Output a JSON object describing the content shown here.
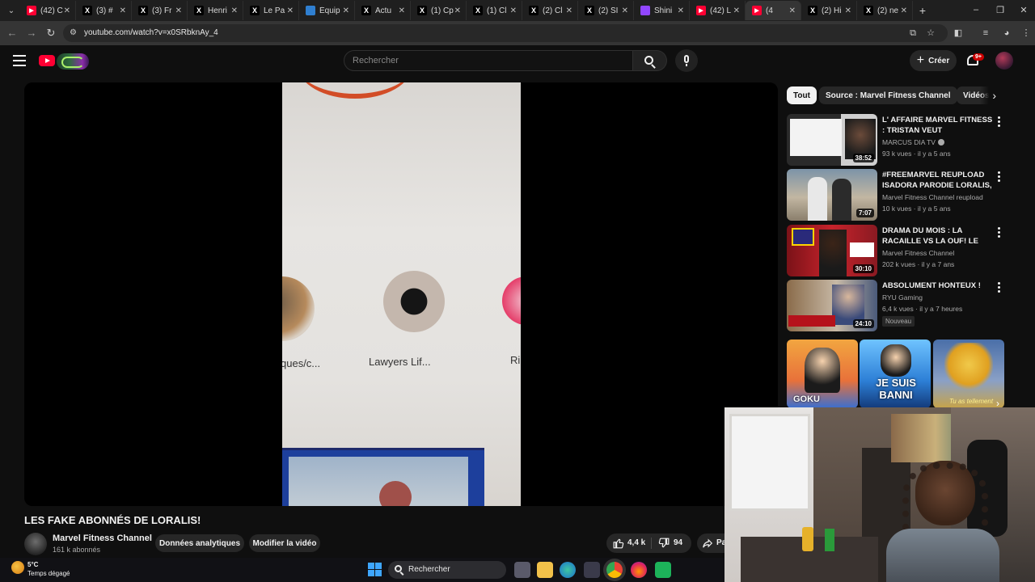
{
  "browser": {
    "tabs": [
      {
        "title": "(42) C",
        "icon": "youtube-icon",
        "color": "#ff0033"
      },
      {
        "title": "(3) #",
        "icon": "x-icon",
        "color": "#000000"
      },
      {
        "title": "(3) Fr",
        "icon": "x-icon",
        "color": "#000000"
      },
      {
        "title": "Henri",
        "icon": "x-icon",
        "color": "#000000"
      },
      {
        "title": "Le Pa",
        "icon": "x-icon",
        "color": "#000000"
      },
      {
        "title": "Équip",
        "icon": "bookmark-icon",
        "color": "#2f7fd0"
      },
      {
        "title": "Actu",
        "icon": "x-icon",
        "color": "#000000"
      },
      {
        "title": "(1) Cp",
        "icon": "x-icon",
        "color": "#000000"
      },
      {
        "title": "(1) Cl",
        "icon": "x-icon",
        "color": "#000000"
      },
      {
        "title": "(2) Cl",
        "icon": "x-icon",
        "color": "#000000"
      },
      {
        "title": "(2) SI",
        "icon": "x-icon",
        "color": "#000000"
      },
      {
        "title": "Shini",
        "icon": "twitch-icon",
        "color": "#9146ff"
      },
      {
        "title": "(42) L",
        "icon": "youtube-icon",
        "color": "#ff0033"
      },
      {
        "title": "(4",
        "icon": "youtube-icon",
        "color": "#ff0033",
        "active": true
      },
      {
        "title": "(2) Hi",
        "icon": "x-icon",
        "color": "#000000"
      },
      {
        "title": "(2) ne",
        "icon": "x-icon",
        "color": "#000000"
      }
    ],
    "url": "youtube.com/watch?v=x0SRbknAy_4"
  },
  "header": {
    "search_placeholder": "Rechercher",
    "create_label": "Créer",
    "notif_badge": "9+"
  },
  "player": {
    "frame_labels": [
      "ques/c...",
      "Lawyers Lif...",
      "Ri"
    ]
  },
  "video": {
    "title": "LES FAKE ABONNÉS DE LORALIS!",
    "channel": "Marvel Fitness Channel",
    "subscribers": "161 k abonnés",
    "analytics_label": "Données analytiques",
    "edit_label": "Modifier la vidéo",
    "likes": "4,4 k",
    "dislikes": "94",
    "share_label": "Pa"
  },
  "sidebar": {
    "chips": [
      "Tout",
      "Source : Marvel Fitness Channel",
      "Vidéos"
    ],
    "recommendations": [
      {
        "title": "L' AFFAIRE MARVEL FITNESS : TRISTAN VEUT S'EXPLIQUER !!!",
        "channel": "MARCUS DIA TV",
        "verified": true,
        "meta": "93 k vues · il y a 5 ans",
        "duration": "38:52"
      },
      {
        "title": "#FREEMARVEL REUPLOAD ISADORA PARODIE   LORALIS, ...",
        "channel": "Marvel Fitness Channel reupload",
        "meta": "10 k vues · il y a 5 ans",
        "duration": "7:07"
      },
      {
        "title": "DRAMA DU MOIS : LA RACAILLE VS LA OUF! LE CAS ...",
        "channel": "Marvel Fitness Channel",
        "meta": "202 k vues · il y a 7 ans",
        "duration": "30:10"
      },
      {
        "title": "ABSOLUMENT HONTEUX !",
        "channel": "RYU Gaming",
        "meta": "6,4 k vues · il y a 7 heures",
        "duration": "24:10",
        "badge": "Nouveau"
      }
    ],
    "shorts": [
      {
        "caption": "GOKU"
      },
      {
        "caption": "JE SUIS BANNI"
      },
      {
        "caption": "Tu as tellement"
      }
    ]
  },
  "taskbar": {
    "temperature": "5°C",
    "condition": "Temps dégagé",
    "search_label": "Rechercher"
  }
}
